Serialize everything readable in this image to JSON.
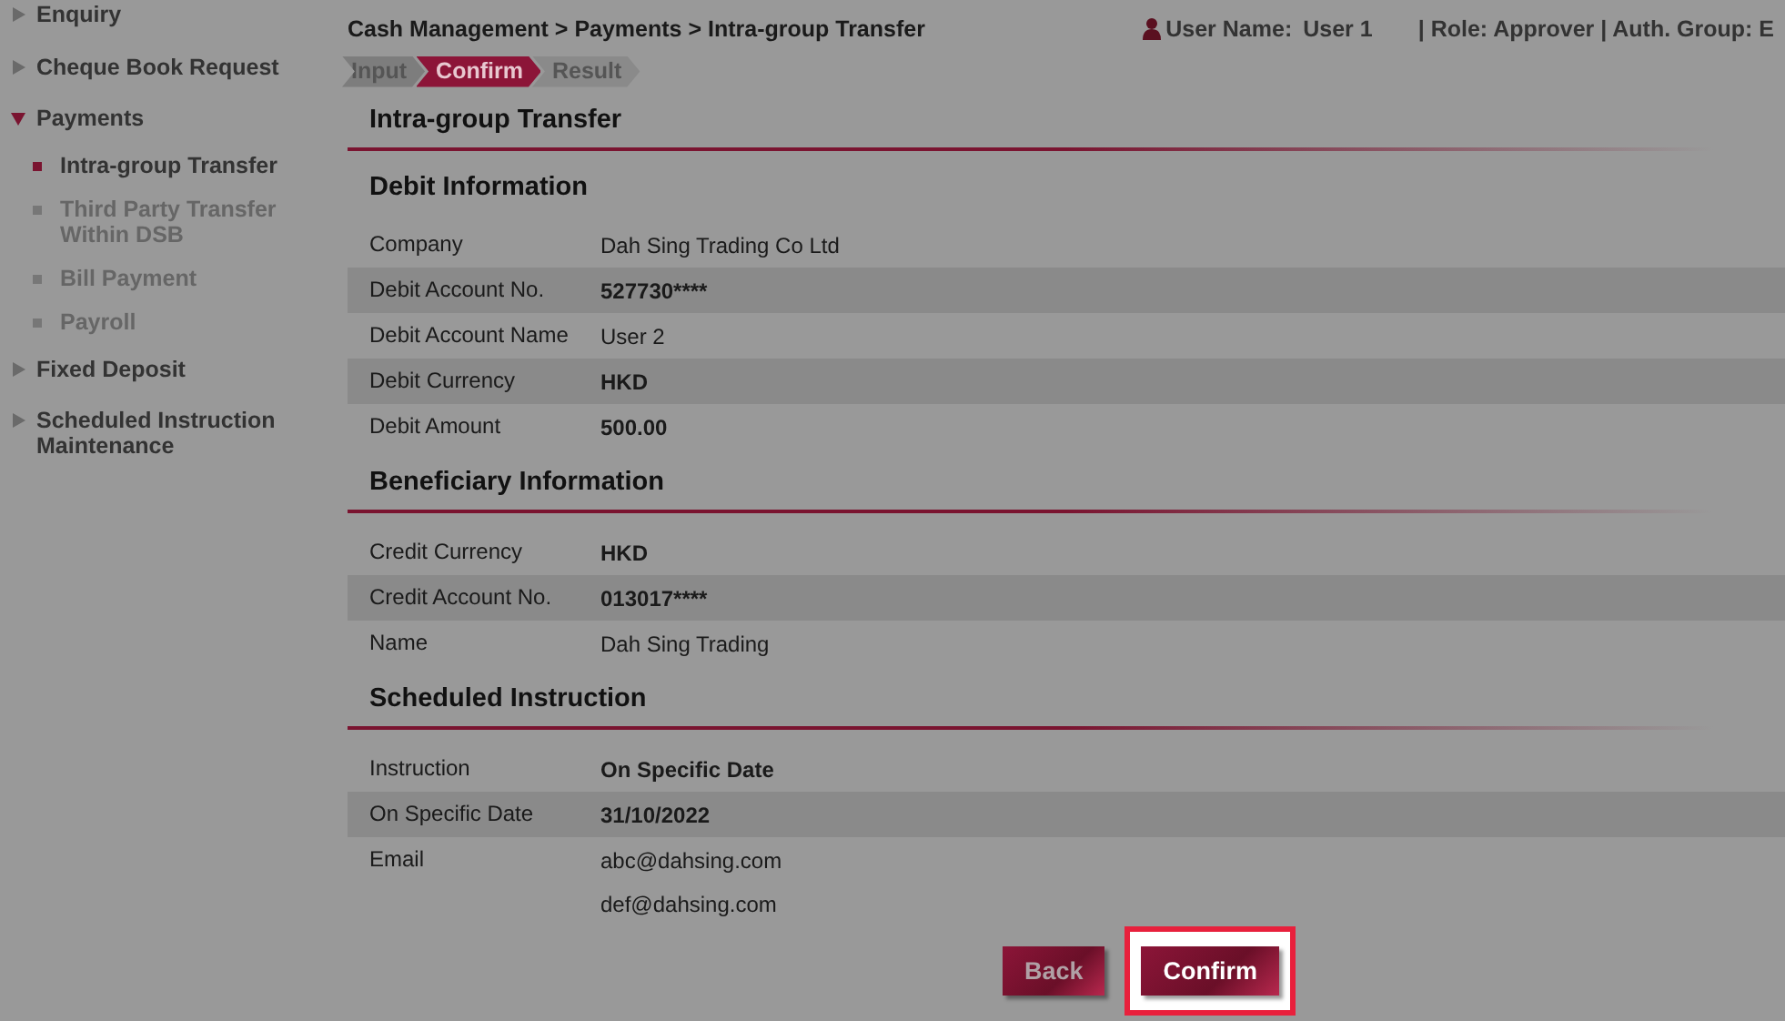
{
  "sidebar": {
    "items": [
      {
        "label": "Enquiry",
        "expanded": false
      },
      {
        "label": "Cheque Book Request",
        "expanded": false
      },
      {
        "label": "Payments",
        "expanded": true,
        "children": [
          {
            "label": "Intra-group Transfer",
            "selected": true
          },
          {
            "label": "Third Party Transfer Within DSB",
            "selected": false
          },
          {
            "label": "Bill Payment",
            "selected": false
          },
          {
            "label": "Payroll",
            "selected": false
          }
        ]
      },
      {
        "label": "Fixed Deposit",
        "expanded": false
      },
      {
        "label": "Scheduled Instruction Maintenance",
        "expanded": false
      }
    ]
  },
  "breadcrumb": "Cash Management > Payments > Intra-group Transfer",
  "steps": [
    {
      "label": "Input",
      "selected": false
    },
    {
      "label": "Confirm",
      "selected": true
    },
    {
      "label": "Result",
      "selected": false
    }
  ],
  "user": {
    "label": "User Name:",
    "value": "User 1",
    "role": "| Role: Approver | Auth. Group: E"
  },
  "page_title": "Intra-group Transfer",
  "sections": [
    {
      "title": "Debit Information",
      "rows": [
        {
          "label": "Company",
          "values": [
            "Dah Sing Trading Co Ltd"
          ],
          "bold": false
        },
        {
          "label": "Debit Account No.",
          "values": [
            "527730****"
          ],
          "bold": true
        },
        {
          "label": "Debit Account Name",
          "values": [
            "User 2"
          ],
          "bold": false
        },
        {
          "label": "Debit Currency",
          "values": [
            "HKD"
          ],
          "bold": true
        },
        {
          "label": "Debit Amount",
          "values": [
            "500.00"
          ],
          "bold": true
        }
      ]
    },
    {
      "title": "Beneficiary Information",
      "rows": [
        {
          "label": "Credit Currency",
          "values": [
            "HKD"
          ],
          "bold": true
        },
        {
          "label": "Credit Account No.",
          "values": [
            "013017****"
          ],
          "bold": true
        },
        {
          "label": "Name",
          "values": [
            "Dah Sing Trading"
          ],
          "bold": false
        }
      ]
    },
    {
      "title": "Scheduled Instruction",
      "rows": [
        {
          "label": "Instruction",
          "values": [
            "On Specific Date"
          ],
          "bold": true
        },
        {
          "label": "On Specific Date",
          "values": [
            "31/10/2022"
          ],
          "bold": true
        },
        {
          "label": "Email",
          "values": [
            "abc@dahsing.com",
            "def@dahsing.com"
          ],
          "bold": false
        }
      ]
    }
  ],
  "buttons": [
    {
      "label": "Back",
      "highlighted": false
    },
    {
      "label": "Confirm",
      "highlighted": true
    }
  ]
}
